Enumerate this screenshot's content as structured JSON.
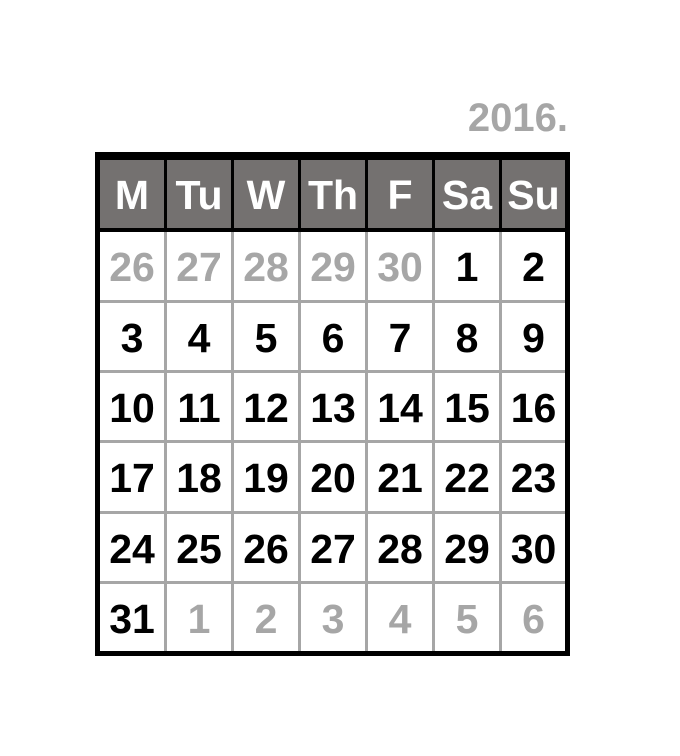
{
  "year": "2016.",
  "weekdays": [
    "M",
    "Tu",
    "W",
    "Th",
    "F",
    "Sa",
    "Su"
  ],
  "weeks": [
    [
      {
        "d": "26",
        "muted": true
      },
      {
        "d": "27",
        "muted": true
      },
      {
        "d": "28",
        "muted": true
      },
      {
        "d": "29",
        "muted": true
      },
      {
        "d": "30",
        "muted": true
      },
      {
        "d": "1",
        "muted": false
      },
      {
        "d": "2",
        "muted": false
      }
    ],
    [
      {
        "d": "3",
        "muted": false
      },
      {
        "d": "4",
        "muted": false
      },
      {
        "d": "5",
        "muted": false
      },
      {
        "d": "6",
        "muted": false
      },
      {
        "d": "7",
        "muted": false
      },
      {
        "d": "8",
        "muted": false
      },
      {
        "d": "9",
        "muted": false
      }
    ],
    [
      {
        "d": "10",
        "muted": false
      },
      {
        "d": "11",
        "muted": false
      },
      {
        "d": "12",
        "muted": false
      },
      {
        "d": "13",
        "muted": false
      },
      {
        "d": "14",
        "muted": false
      },
      {
        "d": "15",
        "muted": false
      },
      {
        "d": "16",
        "muted": false
      }
    ],
    [
      {
        "d": "17",
        "muted": false
      },
      {
        "d": "18",
        "muted": false
      },
      {
        "d": "19",
        "muted": false
      },
      {
        "d": "20",
        "muted": false
      },
      {
        "d": "21",
        "muted": false
      },
      {
        "d": "22",
        "muted": false
      },
      {
        "d": "23",
        "muted": false
      }
    ],
    [
      {
        "d": "24",
        "muted": false
      },
      {
        "d": "25",
        "muted": false
      },
      {
        "d": "26",
        "muted": false
      },
      {
        "d": "27",
        "muted": false
      },
      {
        "d": "28",
        "muted": false
      },
      {
        "d": "29",
        "muted": false
      },
      {
        "d": "30",
        "muted": false
      }
    ],
    [
      {
        "d": "31",
        "muted": false
      },
      {
        "d": "1",
        "muted": true
      },
      {
        "d": "2",
        "muted": true
      },
      {
        "d": "3",
        "muted": true
      },
      {
        "d": "4",
        "muted": true
      },
      {
        "d": "5",
        "muted": true
      },
      {
        "d": "6",
        "muted": true
      }
    ]
  ],
  "colors": {
    "header_bg": "#747170",
    "header_text": "#ffffff",
    "grid_line": "#a6a6a6",
    "border": "#000000",
    "day_text": "#000000",
    "muted_text": "#a6a6a6"
  }
}
